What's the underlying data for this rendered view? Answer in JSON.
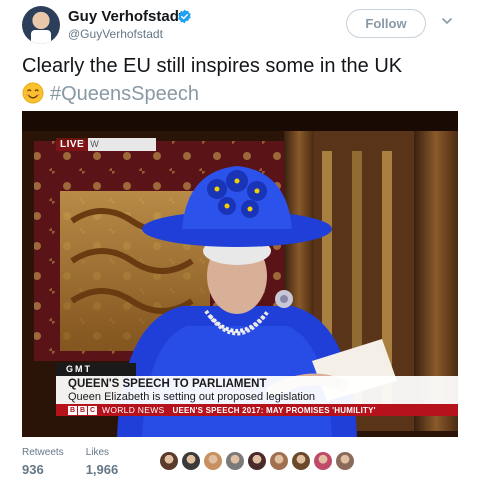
{
  "author": {
    "name": "Guy Verhofstadt",
    "handle": "@GuyVerhofstadt"
  },
  "follow_button": {
    "label": "Follow"
  },
  "tweet": {
    "text": "Clearly the EU still inspires some in the UK",
    "hashtag": "#QueensSpeech",
    "emoji": "smiling-face-icon"
  },
  "media": {
    "live_label": "LIVE",
    "live_letter": "W",
    "gmt_label": "GMT",
    "headline": "QUEEN'S SPEECH TO PARLIAMENT",
    "subline": "Queen Elizabeth is setting out proposed legislation",
    "bbc_letters": [
      "B",
      "B",
      "C"
    ],
    "channel": "WORLD NEWS",
    "ticker": "UEEN'S SPEECH 2017: MAY PROMISES 'HUMILITY'"
  },
  "stats": {
    "retweets_label": "Retweets",
    "retweets_value": "936",
    "likes_label": "Likes",
    "likes_value": "1,966"
  },
  "liker_colors": [
    "#5a3a2a",
    "#3a3a3a",
    "#c89060",
    "#7a7a7a",
    "#4a2a2a",
    "#a07050",
    "#6a4a2a",
    "#c04a6a",
    "#8a6a5a"
  ],
  "colors": {
    "brand_blue": "#1da1f2",
    "hashtag": "#8899a6",
    "hat_blue": "#1f3fd8",
    "bbc_red": "#b5121b"
  }
}
